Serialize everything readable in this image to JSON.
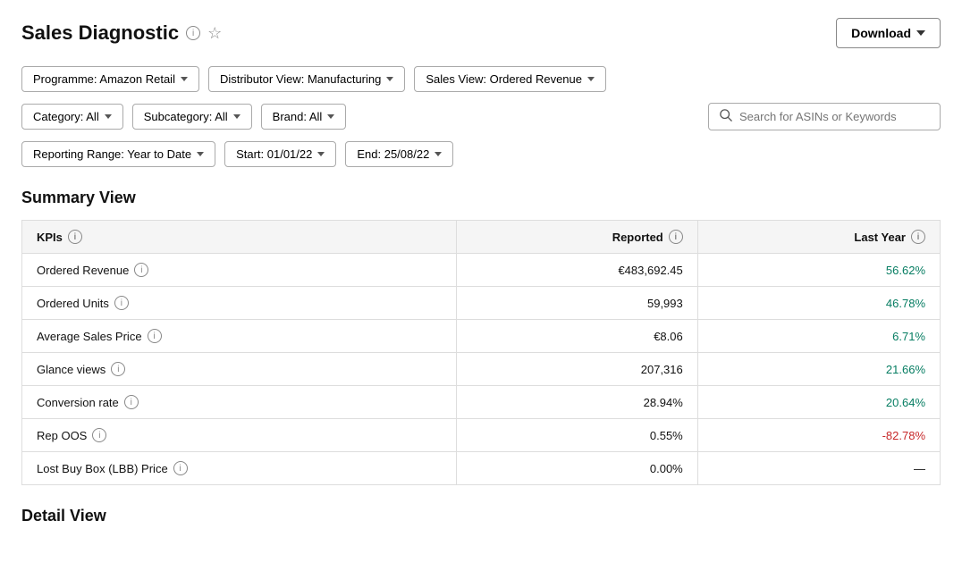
{
  "header": {
    "title": "Sales Diagnostic",
    "download_label": "Download"
  },
  "filters": {
    "row1": [
      {
        "id": "programme",
        "label": "Programme: Amazon Retail"
      },
      {
        "id": "distributor",
        "label": "Distributor View: Manufacturing"
      },
      {
        "id": "sales_view",
        "label": "Sales View: Ordered Revenue"
      }
    ],
    "row2": [
      {
        "id": "category",
        "label": "Category: All"
      },
      {
        "id": "subcategory",
        "label": "Subcategory: All"
      },
      {
        "id": "brand",
        "label": "Brand: All"
      }
    ],
    "row3": [
      {
        "id": "reporting_range",
        "label": "Reporting Range: Year to Date"
      },
      {
        "id": "start",
        "label": "Start: 01/01/22"
      },
      {
        "id": "end",
        "label": "End: 25/08/22"
      }
    ],
    "search_placeholder": "Search for ASINs or Keywords"
  },
  "summary": {
    "title": "Summary View",
    "table": {
      "headers": {
        "kpi": "KPIs",
        "reported": "Reported",
        "last_year": "Last Year"
      },
      "rows": [
        {
          "kpi": "Ordered Revenue",
          "reported": "€483,692.45",
          "last_year": "56.62%",
          "last_year_class": "green"
        },
        {
          "kpi": "Ordered Units",
          "reported": "59,993",
          "last_year": "46.78%",
          "last_year_class": "green"
        },
        {
          "kpi": "Average Sales Price",
          "reported": "€8.06",
          "last_year": "6.71%",
          "last_year_class": "green"
        },
        {
          "kpi": "Glance views",
          "reported": "207,316",
          "last_year": "21.66%",
          "last_year_class": "green"
        },
        {
          "kpi": "Conversion rate",
          "reported": "28.94%",
          "last_year": "20.64%",
          "last_year_class": "green"
        },
        {
          "kpi": "Rep OOS",
          "reported": "0.55%",
          "last_year": "-82.78%",
          "last_year_class": "red"
        },
        {
          "kpi": "Lost Buy Box (LBB) Price",
          "reported": "0.00%",
          "last_year": "—",
          "last_year_class": ""
        }
      ]
    }
  },
  "detail": {
    "title": "Detail View"
  }
}
